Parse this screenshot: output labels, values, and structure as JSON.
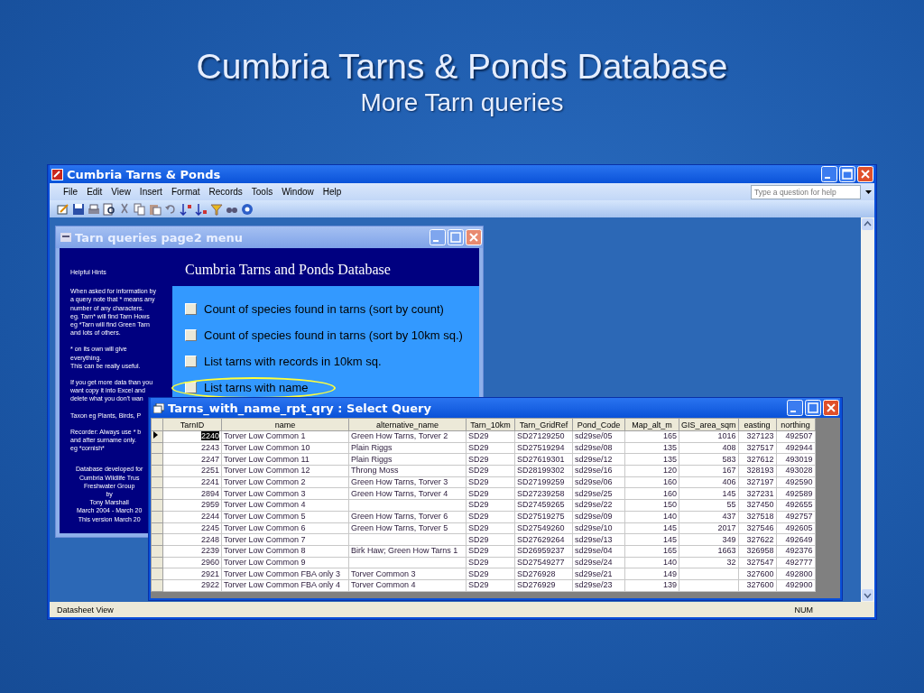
{
  "slide": {
    "title": "Cumbria Tarns & Ponds Database",
    "subtitle": "More Tarn queries"
  },
  "app": {
    "title": "Cumbria Tarns & Ponds",
    "menu": [
      "File",
      "Edit",
      "View",
      "Insert",
      "Format",
      "Records",
      "Tools",
      "Window",
      "Help"
    ],
    "help_box": {
      "placeholder": "Type a question for help"
    },
    "status_bar": {
      "mode": "Datasheet View",
      "indicator": "NUM"
    }
  },
  "menu_form": {
    "title": "Tarn queries page2 menu",
    "hints_heading": "Helpful Hints",
    "hints": [
      "When asked for information by\na query note that * means any\nnumber of any characters.\neg. Tarn* will find Tarn Hows\neg *Tarn will find Green Tarn\nand lots of others.",
      "* on its own will give\neverything.\nThis can be really useful.",
      "If you get more data than you\nwant copy it into Excel and\ndelete what you don't wan",
      "Taxon eg Plants, Birds, P",
      "Recorder: Always use * b\nand after surname only.\neg *cornish*"
    ],
    "credits": "Database developed for\nCumbria Wildlife Trus\nFreshwater Group\nby\nTony Marshall\nMarch 2004 - March 20\nThis version March 20",
    "heading": "Cumbria Tarns and Ponds Database",
    "options": [
      {
        "label": "Count of species found in tarns (sort by count)",
        "highlighted": false
      },
      {
        "label": "Count of species found in tarns (sort by 10km sq.)",
        "highlighted": false
      },
      {
        "label": "List tarns with records in 10km sq.",
        "highlighted": false
      },
      {
        "label": "List tarns with name",
        "highlighted": true
      }
    ]
  },
  "query": {
    "title": "Tarns_with_name_rpt_qry : Select Query",
    "columns": [
      {
        "label": "TarnID",
        "kind": "number"
      },
      {
        "label": "name",
        "kind": "text"
      },
      {
        "label": "alternative_name",
        "kind": "text"
      },
      {
        "label": "Tarn_10km",
        "kind": "text"
      },
      {
        "label": "Tarn_GridRef",
        "kind": "text"
      },
      {
        "label": "Pond_Code",
        "kind": "text"
      },
      {
        "label": "Map_alt_m",
        "kind": "number"
      },
      {
        "label": "GIS_area_sqm",
        "kind": "number"
      },
      {
        "label": "easting",
        "kind": "number"
      },
      {
        "label": "northing",
        "kind": "number"
      }
    ],
    "rows": [
      {
        "selected": true,
        "cells": [
          "2240",
          "Torver Low Common 1",
          "Green How Tarns, Torver 2",
          "SD29",
          "SD27129250",
          "sd29se/05",
          "165",
          "1016",
          "327123",
          "492507"
        ]
      },
      {
        "selected": false,
        "cells": [
          "2243",
          "Torver Low Common 10",
          "Plain Riggs",
          "SD29",
          "SD27519294",
          "sd29se/08",
          "135",
          "408",
          "327517",
          "492944"
        ]
      },
      {
        "selected": false,
        "cells": [
          "2247",
          "Torver Low Common 11",
          "Plain Riggs",
          "SD29",
          "SD27619301",
          "sd29se/12",
          "135",
          "583",
          "327612",
          "493019"
        ]
      },
      {
        "selected": false,
        "cells": [
          "2251",
          "Torver Low Common 12",
          "Throng Moss",
          "SD29",
          "SD28199302",
          "sd29se/16",
          "120",
          "167",
          "328193",
          "493028"
        ]
      },
      {
        "selected": false,
        "cells": [
          "2241",
          "Torver Low Common 2",
          "Green How Tarns, Torver 3",
          "SD29",
          "SD27199259",
          "sd29se/06",
          "160",
          "406",
          "327197",
          "492590"
        ]
      },
      {
        "selected": false,
        "cells": [
          "2894",
          "Torver Low Common 3",
          "Green How Tarns, Torver 4",
          "SD29",
          "SD27239258",
          "sd29se/25",
          "160",
          "145",
          "327231",
          "492589"
        ]
      },
      {
        "selected": false,
        "cells": [
          "2959",
          "Torver Low Common 4",
          null,
          "SD29",
          "SD27459265",
          "sd29se/22",
          "150",
          "55",
          "327450",
          "492655"
        ]
      },
      {
        "selected": false,
        "cells": [
          "2244",
          "Torver Low Common 5",
          "Green How Tarns, Torver 6",
          "SD29",
          "SD27519275",
          "sd29se/09",
          "140",
          "437",
          "327518",
          "492757"
        ]
      },
      {
        "selected": false,
        "cells": [
          "2245",
          "Torver Low Common 6",
          "Green How Tarns, Torver 5",
          "SD29",
          "SD27549260",
          "sd29se/10",
          "145",
          "2017",
          "327546",
          "492605"
        ]
      },
      {
        "selected": false,
        "cells": [
          "2248",
          "Torver Low Common 7",
          null,
          "SD29",
          "SD27629264",
          "sd29se/13",
          "145",
          "349",
          "327622",
          "492649"
        ]
      },
      {
        "selected": false,
        "cells": [
          "2239",
          "Torver Low Common 8",
          "Birk Haw; Green How Tarns 1",
          "SD29",
          "SD26959237",
          "sd29se/04",
          "165",
          "1663",
          "326958",
          "492376"
        ]
      },
      {
        "selected": false,
        "cells": [
          "2960",
          "Torver Low Common 9",
          null,
          "SD29",
          "SD27549277",
          "sd29se/24",
          "140",
          "32",
          "327547",
          "492777"
        ]
      },
      {
        "selected": false,
        "cells": [
          "2921",
          "Torver Low Common FBA only 3",
          "Torver Common 3",
          "SD29",
          "SD276928",
          "sd29se/21",
          "149",
          null,
          "327600",
          "492800"
        ]
      },
      {
        "selected": false,
        "cells": [
          "2922",
          "Torver Low Common FBA only 4",
          "Torver Common 4",
          "SD29",
          "SD276929",
          "sd29se/23",
          "139",
          null,
          "327600",
          "492900"
        ]
      }
    ]
  }
}
